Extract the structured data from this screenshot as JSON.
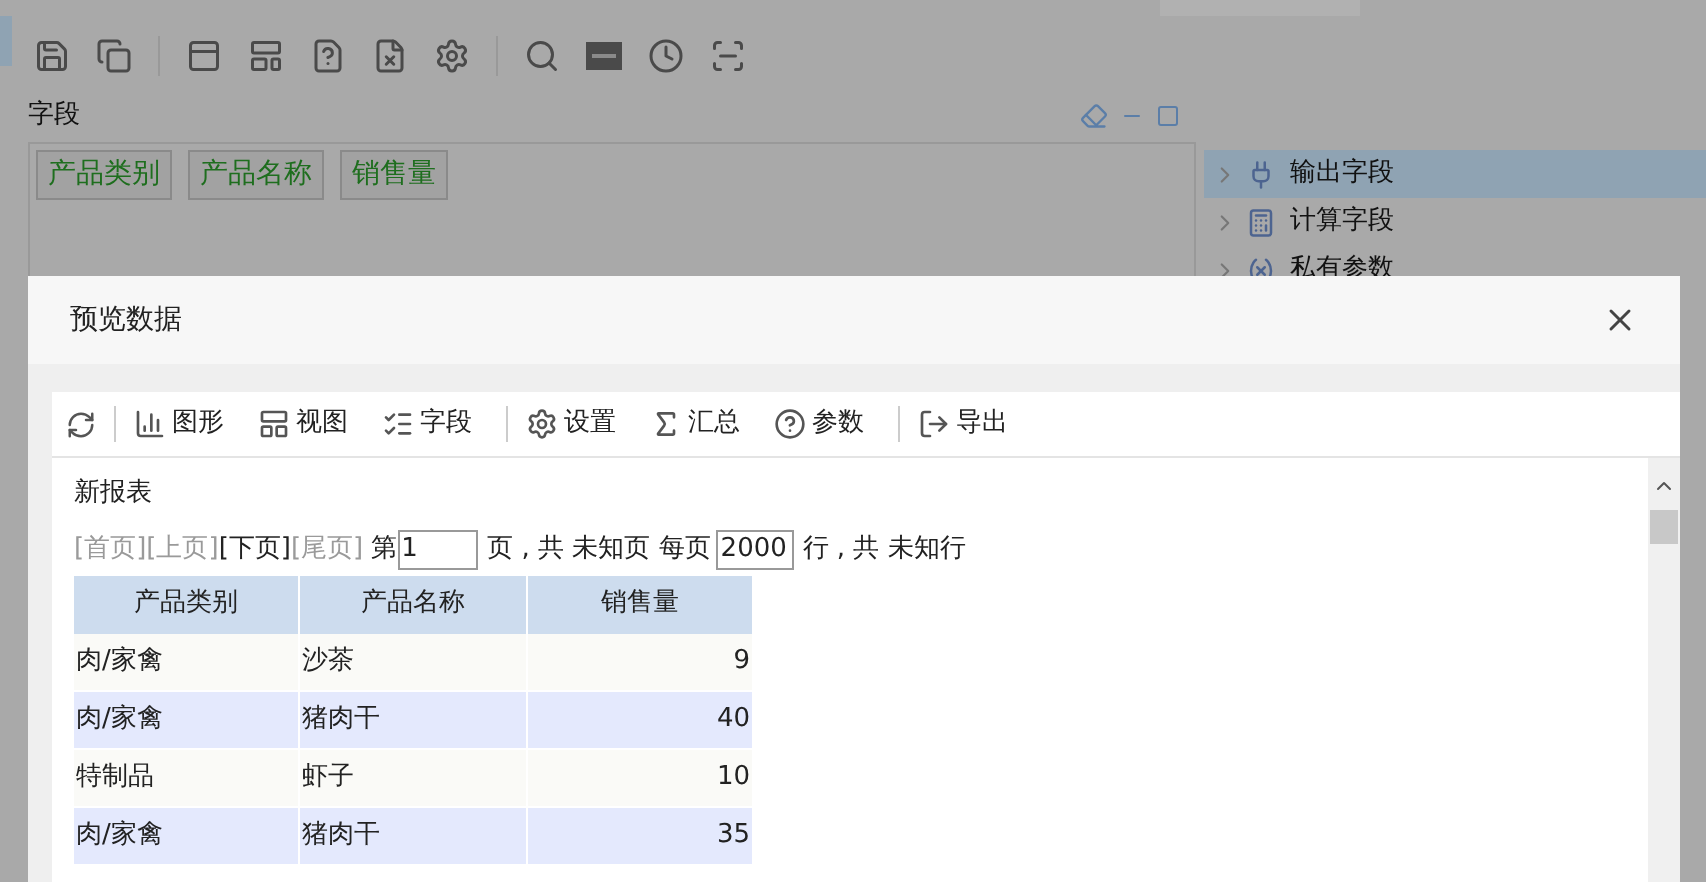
{
  "background": {
    "panel_title": "字段",
    "fields": [
      "产品类别",
      "产品名称",
      "销售量"
    ],
    "tree": [
      {
        "label": "输出字段",
        "selected": true
      },
      {
        "label": "计算字段",
        "selected": false
      },
      {
        "label": "私有参数",
        "selected": false
      }
    ]
  },
  "dialog": {
    "title": "预览数据",
    "toolbar": [
      [
        "图形",
        "视图",
        "字段"
      ],
      [
        "设置",
        "汇总",
        "参数"
      ],
      [
        "导出"
      ]
    ],
    "report_title": "新报表",
    "pager": {
      "links": [
        {
          "label": "[首页]",
          "disabled": true
        },
        {
          "label": "[上页]",
          "disabled": true
        },
        {
          "label": "[下页]",
          "disabled": false
        },
        {
          "label": "[尾页]",
          "disabled": true
        }
      ],
      "page_prefix": "第",
      "page_value": "1",
      "page_suffix": "页 , 共 未知页 每页",
      "rows_value": "2000",
      "rows_suffix": "行 , 共 未知行"
    },
    "table": {
      "columns": [
        "产品类别",
        "产品名称",
        "销售量"
      ],
      "rows": [
        [
          "肉/家禽",
          "沙茶",
          "9"
        ],
        [
          "肉/家禽",
          "猪肉干",
          "40"
        ],
        [
          "特制品",
          "虾子",
          "10"
        ],
        [
          "肉/家禽",
          "猪肉干",
          "35"
        ]
      ]
    }
  }
}
